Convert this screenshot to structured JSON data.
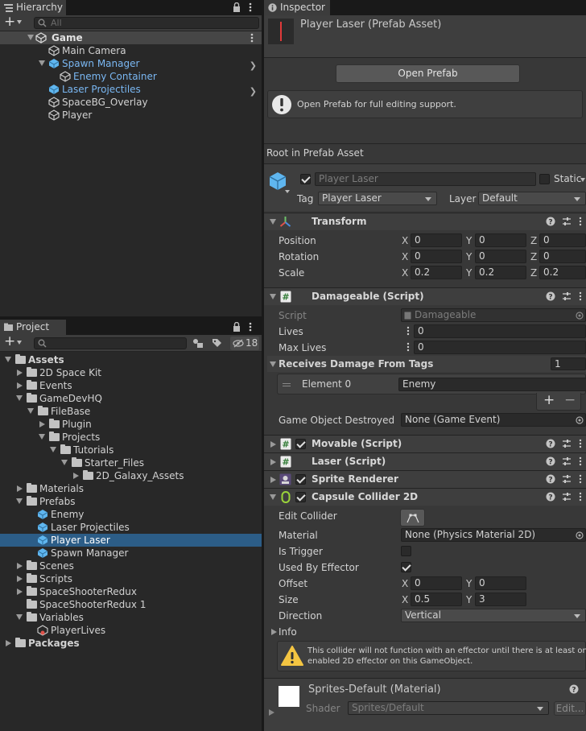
{
  "hierarchy": {
    "tab_title": "Hierarchy",
    "add_label": "+",
    "search_placeholder": "All",
    "scene_name": "Game",
    "items": [
      {
        "label": "Main Camera"
      },
      {
        "label": "Spawn Manager"
      },
      {
        "label": "Enemy Container"
      },
      {
        "label": "Laser Projectiles"
      },
      {
        "label": "SpaceBG_Overlay"
      },
      {
        "label": "Player"
      }
    ]
  },
  "project": {
    "tab_title": "Project",
    "add_label": "+",
    "hidden_count": "18",
    "tree": [
      {
        "label": "Assets"
      },
      {
        "label": "2D Space Kit"
      },
      {
        "label": "Events"
      },
      {
        "label": "GameDevHQ"
      },
      {
        "label": "FileBase"
      },
      {
        "label": "Plugin"
      },
      {
        "label": "Projects"
      },
      {
        "label": "Tutorials"
      },
      {
        "label": "Starter_Files"
      },
      {
        "label": "2D_Galaxy_Assets"
      },
      {
        "label": "Materials"
      },
      {
        "label": "Prefabs"
      },
      {
        "label": "Enemy"
      },
      {
        "label": "Laser Projectiles"
      },
      {
        "label": "Player Laser"
      },
      {
        "label": "Spawn Manager"
      },
      {
        "label": "Scenes"
      },
      {
        "label": "Scripts"
      },
      {
        "label": "SpaceShooterRedux"
      },
      {
        "label": "SpaceShooterRedux 1"
      },
      {
        "label": "Variables"
      },
      {
        "label": "PlayerLives"
      },
      {
        "label": "Packages"
      }
    ]
  },
  "inspector": {
    "tab_title": "Inspector",
    "asset_title": "Player Laser (Prefab Asset)",
    "open_prefab": "Open Prefab",
    "info_message": "Open Prefab for full editing support.",
    "root_label": "Root in Prefab Asset",
    "object_name": "Player Laser",
    "static_label": "Static",
    "tag_label": "Tag",
    "tag_value": "Player Laser",
    "layer_label": "Layer",
    "layer_value": "Default",
    "transform": {
      "title": "Transform",
      "position_label": "Position",
      "rotation_label": "Rotation",
      "scale_label": "Scale",
      "x": "X",
      "y": "Y",
      "z": "Z",
      "position": [
        "0",
        "0",
        "0"
      ],
      "rotation": [
        "0",
        "0",
        "0"
      ],
      "scale": [
        "0.2",
        "0.2",
        "0.2"
      ]
    },
    "damageable": {
      "title": "Damageable (Script)",
      "script_label": "Script",
      "script_value": "Damageable",
      "lives_label": "Lives",
      "lives_value": "0",
      "max_lives_label": "Max Lives",
      "max_lives_value": "0",
      "tags_label": "Receives Damage From Tags",
      "tags_count": "1",
      "element_label": "Element 0",
      "element_value": "Enemy",
      "plus": "+",
      "minus": "−",
      "destroyed_label": "Game Object Destroyed",
      "destroyed_value": "None (Game Event)"
    },
    "movable_title": "Movable (Script)",
    "laser_title": "Laser (Script)",
    "sprite_title": "Sprite Renderer",
    "collider": {
      "title": "Capsule Collider 2D",
      "edit_label": "Edit Collider",
      "material_label": "Material",
      "material_value": "None (Physics Material 2D)",
      "trigger_label": "Is Trigger",
      "effector_label": "Used By Effector",
      "offset_label": "Offset",
      "offset": [
        "0",
        "0"
      ],
      "size_label": "Size",
      "size": [
        "0.5",
        "3"
      ],
      "direction_label": "Direction",
      "direction_value": "Vertical",
      "info_label": "Info",
      "warning_line1": "This collider will not function with an effector until there is at least one",
      "warning_line2": "enabled 2D effector on this GameObject."
    },
    "material": {
      "title": "Sprites-Default (Material)",
      "shader_label": "Shader",
      "shader_value": "Sprites/Default",
      "edit_label": "Edit..."
    }
  },
  "colors": {
    "selection": "#2c5d87",
    "prefab_blue": "#7ab7f2",
    "panel": "#282828",
    "inspector": "#383838"
  }
}
